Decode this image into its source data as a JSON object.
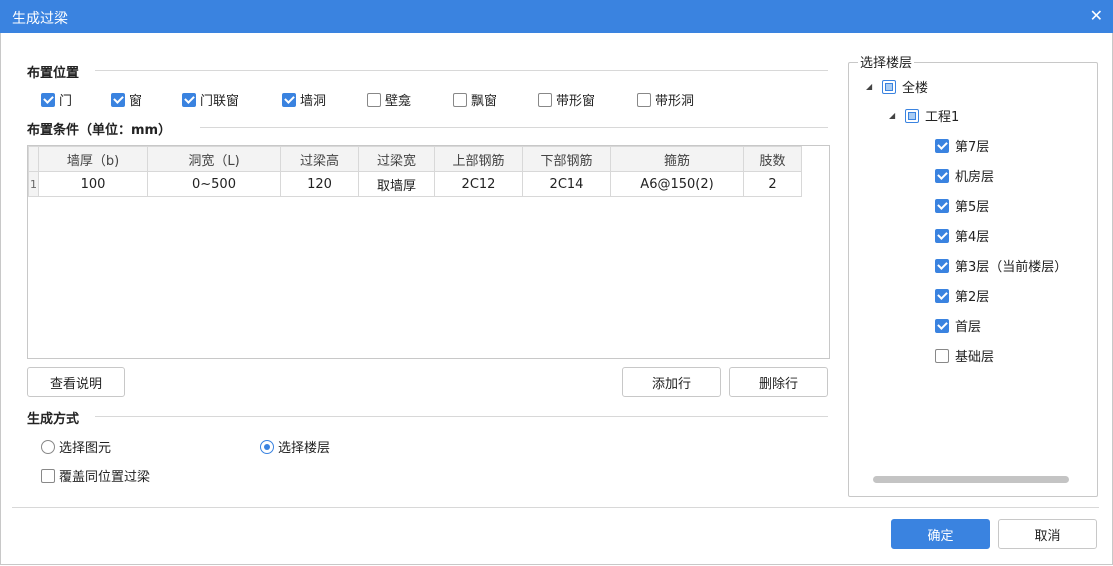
{
  "window": {
    "title": "生成过梁",
    "close_glyph": "✕"
  },
  "layout_section": {
    "label": "布置位置",
    "options": [
      {
        "label": "门",
        "checked": true
      },
      {
        "label": "窗",
        "checked": true
      },
      {
        "label": "门联窗",
        "checked": true
      },
      {
        "label": "墙洞",
        "checked": true
      },
      {
        "label": "壁龛",
        "checked": false
      },
      {
        "label": "飘窗",
        "checked": false
      },
      {
        "label": "带形窗",
        "checked": false
      },
      {
        "label": "带形洞",
        "checked": false
      }
    ]
  },
  "conditions": {
    "label": "布置条件（单位：mm）",
    "columns": [
      "墙厚（b)",
      "洞宽（L)",
      "过梁高",
      "过梁宽",
      "上部钢筋",
      "下部钢筋",
      "箍筋",
      "肢数"
    ],
    "rows": [
      {
        "index": "1",
        "cells": [
          "100",
          "0~500",
          "120",
          "取墙厚",
          "2C12",
          "2C14",
          "A6@150(2)",
          "2"
        ]
      }
    ]
  },
  "buttons": {
    "view_help": "查看说明",
    "add_row": "添加行",
    "delete_row": "删除行",
    "ok": "确定",
    "cancel": "取消"
  },
  "generate": {
    "label": "生成方式",
    "radio_select_element": "选择图元",
    "radio_select_floor": "选择楼层",
    "selected": "选择楼层",
    "overwrite_label": "覆盖同位置过梁",
    "overwrite_checked": false
  },
  "floor_panel": {
    "title": "选择楼层",
    "root": {
      "label": "全楼",
      "state": "partial"
    },
    "project": {
      "label": "工程1",
      "state": "partial"
    },
    "floors": [
      {
        "label": "第7层",
        "checked": true
      },
      {
        "label": "机房层",
        "checked": true
      },
      {
        "label": "第5层",
        "checked": true
      },
      {
        "label": "第4层",
        "checked": true
      },
      {
        "label": "第3层（当前楼层）",
        "checked": true
      },
      {
        "label": "第2层",
        "checked": true
      },
      {
        "label": "首层",
        "checked": true
      },
      {
        "label": "基础层",
        "checked": false
      }
    ]
  },
  "colors": {
    "accent": "#3a83e0"
  }
}
